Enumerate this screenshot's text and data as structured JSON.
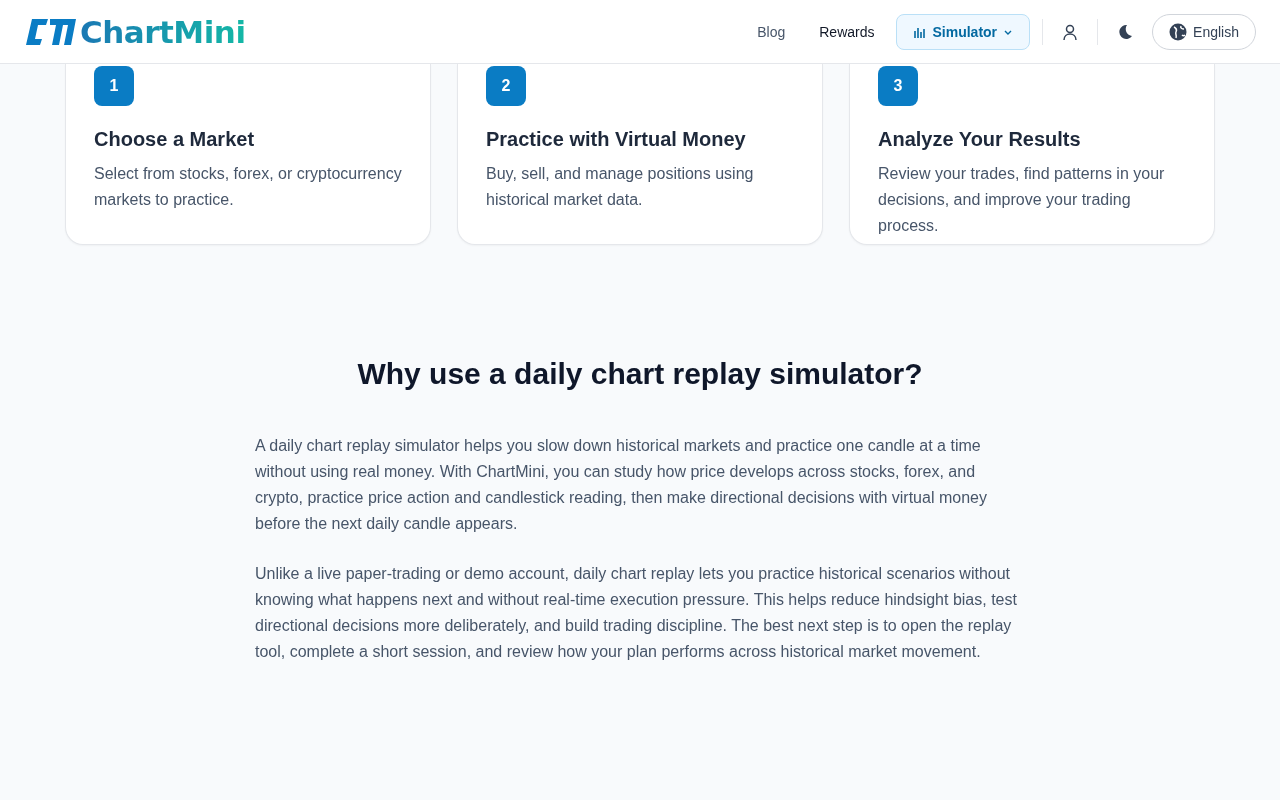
{
  "header": {
    "logo": "ChartMini",
    "nav": [
      {
        "label": "Blog",
        "selected": false
      },
      {
        "label": "Rewards",
        "selected": false
      },
      {
        "label": "Simulator",
        "selected": true
      }
    ],
    "language": "English"
  },
  "steps": [
    {
      "number": "1",
      "title": "Choose a Market",
      "text": "Select from stocks, forex, or cryptocurrency markets to practice."
    },
    {
      "number": "2",
      "title": "Practice with Virtual Money",
      "text": "Buy, sell, and manage positions using historical market data."
    },
    {
      "number": "3",
      "title": "Analyze Your Results",
      "text": "Review your trades, find patterns in your decisions, and improve your trading process."
    }
  ],
  "section": {
    "heading": "Why use a daily chart replay simulator?",
    "paragraphs": [
      "A daily chart replay simulator helps you slow down historical markets and practice one candle at a time without using real money. With ChartMini, you can study how price develops across stocks, forex, and crypto, practice price action and candlestick reading, then make directional decisions with virtual money before the next daily candle appears.",
      "Unlike a live paper-trading or demo account, daily chart replay lets you practice historical scenarios without knowing what happens next and without real-time execution pressure. This helps reduce hindsight bias, test directional decisions more deliberately, and build trading discipline. The best next step is to open the replay tool, complete a short session, and review how your plan performs across historical market movement."
    ]
  }
}
